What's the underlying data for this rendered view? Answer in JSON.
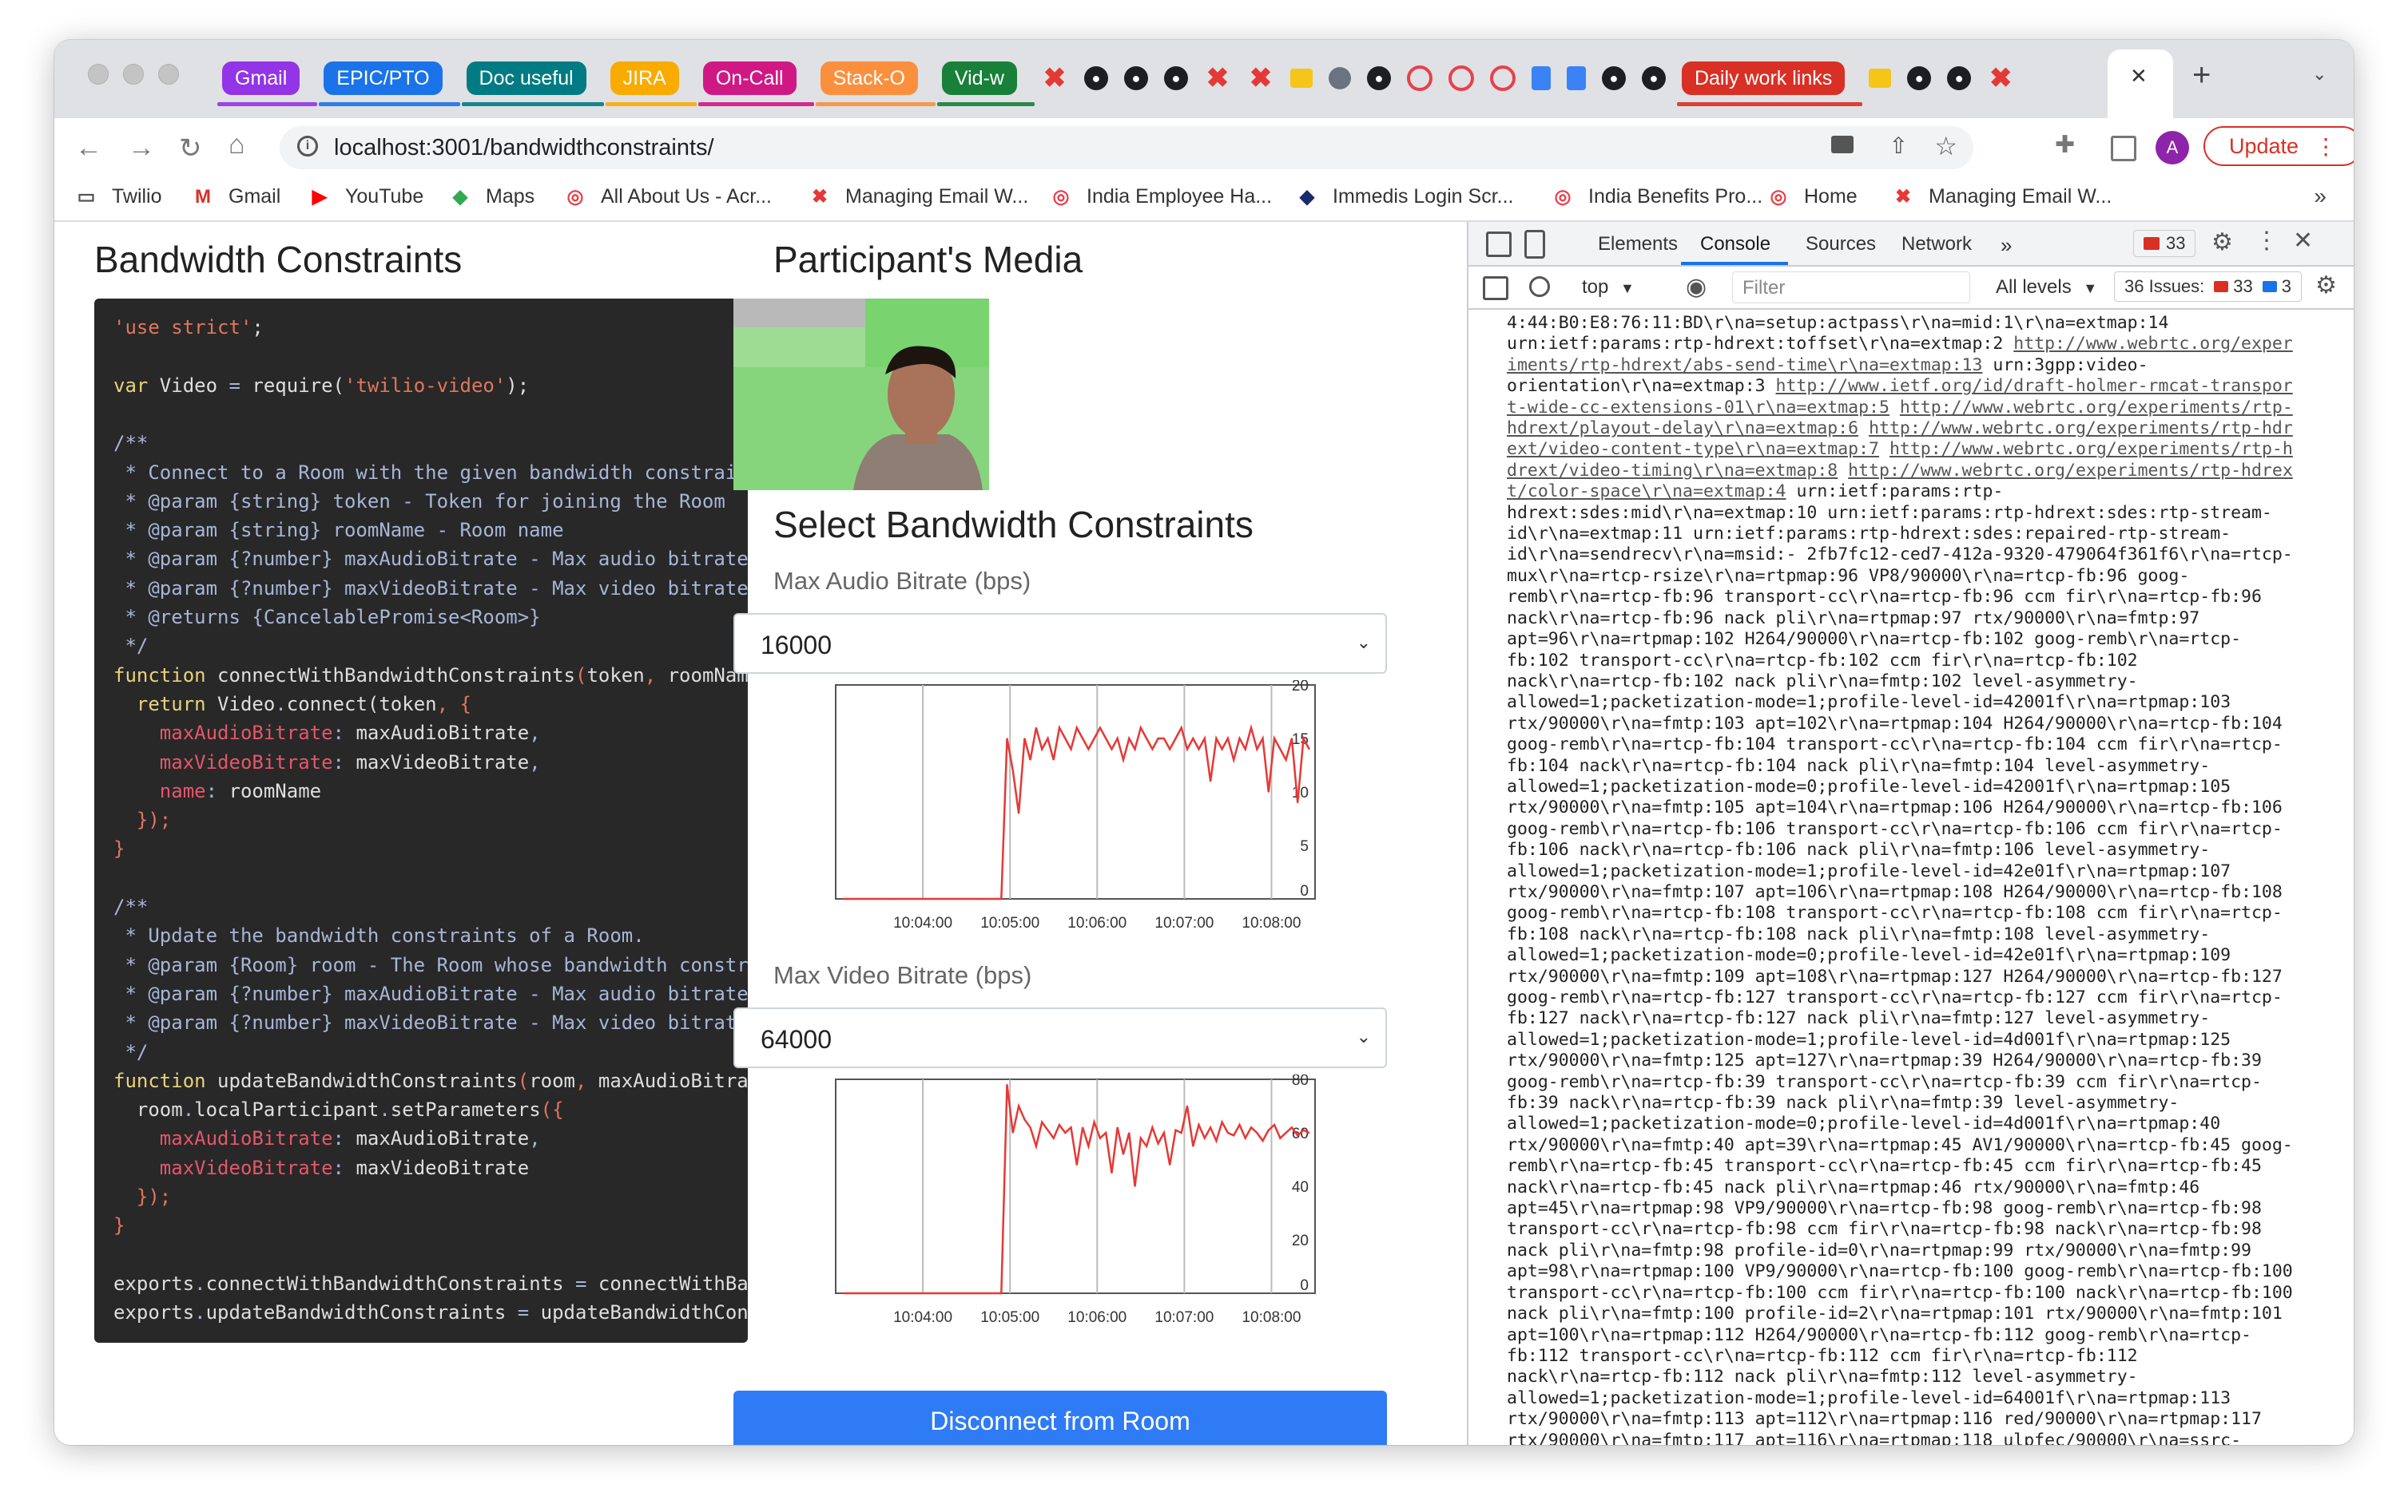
{
  "tabstrip": {
    "group_tabs": [
      {
        "label": "Gmail",
        "color": "#9334e6"
      },
      {
        "label": "EPIC/PTO",
        "color": "#1a73e8"
      },
      {
        "label": "Doc useful",
        "color": "#007b83"
      },
      {
        "label": "JIRA",
        "color": "#f9ab00"
      },
      {
        "label": "On-Call",
        "color": "#d01884"
      },
      {
        "label": "Stack-O",
        "color": "#fa903e"
      },
      {
        "label": "Vid-w",
        "color": "#188038"
      }
    ],
    "daily_tab": {
      "label": "Daily work links",
      "color": "#d93025"
    },
    "close_glyph": "✕",
    "new_tab_glyph": "+"
  },
  "toolbar": {
    "url": "localhost:3001/bandwidthconstraints/",
    "avatar_letter": "A",
    "update_label": "Update"
  },
  "bookmarks": [
    {
      "label": "Twilio",
      "icon": "folder-icon"
    },
    {
      "label": "Gmail",
      "icon": "gmail-icon"
    },
    {
      "label": "YouTube",
      "icon": "youtube-icon"
    },
    {
      "label": "Maps",
      "icon": "maps-icon"
    },
    {
      "label": "All About Us - Acr...",
      "icon": "circle-logo-icon"
    },
    {
      "label": "Managing Email W...",
      "icon": "x-logo-icon"
    },
    {
      "label": "India Employee Ha...",
      "icon": "circle-logo-icon"
    },
    {
      "label": "Immedis Login Scr...",
      "icon": "immedis-icon"
    },
    {
      "label": "India Benefits Pro...",
      "icon": "circle-logo-icon"
    },
    {
      "label": "Home",
      "icon": "circle-logo-icon"
    },
    {
      "label": "Managing Email W...",
      "icon": "x-logo-icon"
    }
  ],
  "bookmarks_overflow": "»",
  "page": {
    "left_title": "Bandwidth Constraints",
    "right_title": "Participant's Media",
    "select_title": "Select Bandwidth Constraints",
    "audio_label": "Max Audio Bitrate (bps)",
    "audio_value": "16000",
    "video_label": "Max Video Bitrate (bps)",
    "video_value": "64000",
    "disconnect_label": "Disconnect from Room"
  },
  "code_lines": [
    [
      [
        "s",
        "'use strict'"
      ],
      [
        "f",
        ";"
      ]
    ],
    [],
    [
      [
        "k",
        "var "
      ],
      [
        "f",
        "Video "
      ],
      [
        "c",
        "= "
      ],
      [
        "f",
        "require("
      ],
      [
        "s",
        "'twilio-video'"
      ],
      [
        "f",
        ");"
      ]
    ],
    [],
    [
      [
        "c",
        "/**"
      ]
    ],
    [
      [
        "c",
        " * Connect to a Room with the given bandwidth constrain"
      ]
    ],
    [
      [
        "c",
        " * @param {string} token - Token for joining the Room"
      ]
    ],
    [
      [
        "c",
        " * @param {string} roomName - Room name"
      ]
    ],
    [
      [
        "c",
        " * @param {?number} maxAudioBitrate - Max audio bitrate"
      ]
    ],
    [
      [
        "c",
        " * @param {?number} maxVideoBitrate - Max video bitrate"
      ]
    ],
    [
      [
        "c",
        " * @returns {CancelablePromise<Room>}"
      ]
    ],
    [
      [
        "c",
        " */"
      ]
    ],
    [
      [
        "k",
        "function "
      ],
      [
        "f",
        "connectWithBandwidthConstraints"
      ],
      [
        "s",
        "("
      ],
      [
        "f",
        "token"
      ],
      [
        "s",
        ", "
      ],
      [
        "f",
        "roomNam"
      ]
    ],
    [
      [
        "k",
        "  return "
      ],
      [
        "f",
        "Video"
      ],
      [
        "c",
        "."
      ],
      [
        "f",
        "connect(token"
      ],
      [
        "s",
        ", {"
      ]
    ],
    [
      [
        "p",
        "    maxAudioBitrate"
      ],
      [
        "c",
        ": "
      ],
      [
        "f",
        "maxAudioBitrate"
      ],
      [
        "c",
        ","
      ]
    ],
    [
      [
        "p",
        "    maxVideoBitrate"
      ],
      [
        "c",
        ": "
      ],
      [
        "f",
        "maxVideoBitrate"
      ],
      [
        "c",
        ","
      ]
    ],
    [
      [
        "p",
        "    name"
      ],
      [
        "c",
        ": "
      ],
      [
        "f",
        "roomName"
      ]
    ],
    [
      [
        "s",
        "  });"
      ]
    ],
    [
      [
        "s",
        "}"
      ]
    ],
    [],
    [
      [
        "c",
        "/**"
      ]
    ],
    [
      [
        "c",
        " * Update the bandwidth constraints of a Room."
      ]
    ],
    [
      [
        "c",
        " * @param {Room} room - The Room whose bandwidth constr"
      ]
    ],
    [
      [
        "c",
        " * @param {?number} maxAudioBitrate - Max audio bitrate"
      ]
    ],
    [
      [
        "c",
        " * @param {?number} maxVideoBitrate - Max video bitrate"
      ]
    ],
    [
      [
        "c",
        " */"
      ]
    ],
    [
      [
        "k",
        "function "
      ],
      [
        "f",
        "updateBandwidthConstraints"
      ],
      [
        "s",
        "("
      ],
      [
        "f",
        "room"
      ],
      [
        "s",
        ", "
      ],
      [
        "f",
        "maxAudioBitra"
      ]
    ],
    [
      [
        "f",
        "  room"
      ],
      [
        "c",
        "."
      ],
      [
        "f",
        "localParticipant"
      ],
      [
        "c",
        "."
      ],
      [
        "f",
        "setParameters"
      ],
      [
        "s",
        "({"
      ]
    ],
    [
      [
        "p",
        "    maxAudioBitrate"
      ],
      [
        "c",
        ": "
      ],
      [
        "f",
        "maxAudioBitrate"
      ],
      [
        "c",
        ","
      ]
    ],
    [
      [
        "p",
        "    maxVideoBitrate"
      ],
      [
        "c",
        ": "
      ],
      [
        "f",
        "maxVideoBitrate"
      ]
    ],
    [
      [
        "s",
        "  });"
      ]
    ],
    [
      [
        "s",
        "}"
      ]
    ],
    [],
    [
      [
        "f",
        "exports"
      ],
      [
        "c",
        "."
      ],
      [
        "f",
        "connectWithBandwidthConstraints "
      ],
      [
        "c",
        "= "
      ],
      [
        "f",
        "connectWithBa"
      ]
    ],
    [
      [
        "f",
        "exports"
      ],
      [
        "c",
        "."
      ],
      [
        "f",
        "updateBandwidthConstraints "
      ],
      [
        "c",
        "= "
      ],
      [
        "f",
        "updateBandwidthCon"
      ]
    ]
  ],
  "devtools": {
    "tabs": [
      "Elements",
      "Console",
      "Sources",
      "Network"
    ],
    "active_tab": "Console",
    "overflow": "»",
    "error_badge": "33",
    "context": "top",
    "filter_placeholder": "Filter",
    "levels": "All levels",
    "issues_label": "36 Issues:",
    "issues_errors": "33",
    "issues_info": "3",
    "console_lines": [
      [
        [
          "t",
          "4:44:B0:E8:76:11:BD\\r\\na=setup:actpass\\r\\na=mid:1\\r\\na=extmap:14"
        ]
      ],
      [
        [
          "t",
          "urn:ietf:params:rtp-hdrext:toffset\\r\\na=extmap:2 "
        ],
        [
          "l",
          "http://www.webrtc.org/exper"
        ]
      ],
      [
        [
          "l",
          "iments/rtp-hdrext/abs-send-time\\r\\na=extmap:13"
        ],
        [
          "t",
          " urn:3gpp:video-"
        ]
      ],
      [
        [
          "t",
          "orientation\\r\\na=extmap:3 "
        ],
        [
          "l",
          "http://www.ietf.org/id/draft-holmer-rmcat-transpor"
        ]
      ],
      [
        [
          "l",
          "t-wide-cc-extensions-01\\r\\na=extmap:5"
        ],
        [
          "t",
          " "
        ],
        [
          "l",
          "http://www.webrtc.org/experiments/rtp-"
        ]
      ],
      [
        [
          "l",
          "hdrext/playout-delay\\r\\na=extmap:6"
        ],
        [
          "t",
          " "
        ],
        [
          "l",
          "http://www.webrtc.org/experiments/rtp-hdr"
        ]
      ],
      [
        [
          "l",
          "ext/video-content-type\\r\\na=extmap:7"
        ],
        [
          "t",
          " "
        ],
        [
          "l",
          "http://www.webrtc.org/experiments/rtp-h"
        ]
      ],
      [
        [
          "l",
          "drext/video-timing\\r\\na=extmap:8"
        ],
        [
          "t",
          " "
        ],
        [
          "l",
          "http://www.webrtc.org/experiments/rtp-hdrex"
        ]
      ],
      [
        [
          "l",
          "t/color-space\\r\\na=extmap:4"
        ],
        [
          "t",
          " urn:ietf:params:rtp-"
        ]
      ],
      [
        [
          "t",
          "hdrext:sdes:mid\\r\\na=extmap:10 urn:ietf:params:rtp-hdrext:sdes:rtp-stream-"
        ]
      ],
      [
        [
          "t",
          "id\\r\\na=extmap:11 urn:ietf:params:rtp-hdrext:sdes:repaired-rtp-stream-"
        ]
      ],
      [
        [
          "t",
          "id\\r\\na=sendrecv\\r\\na=msid:- 2fb7fc12-ced7-412a-9320-479064f361f6\\r\\na=rtcp-"
        ]
      ],
      [
        [
          "t",
          "mux\\r\\na=rtcp-rsize\\r\\na=rtpmap:96 VP8/90000\\r\\na=rtcp-fb:96 goog-"
        ]
      ],
      [
        [
          "t",
          "remb\\r\\na=rtcp-fb:96 transport-cc\\r\\na=rtcp-fb:96 ccm fir\\r\\na=rtcp-fb:96"
        ]
      ],
      [
        [
          "t",
          "nack\\r\\na=rtcp-fb:96 nack pli\\r\\na=rtpmap:97 rtx/90000\\r\\na=fmtp:97"
        ]
      ],
      [
        [
          "t",
          "apt=96\\r\\na=rtpmap:102 H264/90000\\r\\na=rtcp-fb:102 goog-remb\\r\\na=rtcp-"
        ]
      ],
      [
        [
          "t",
          "fb:102 transport-cc\\r\\na=rtcp-fb:102 ccm fir\\r\\na=rtcp-fb:102"
        ]
      ],
      [
        [
          "t",
          "nack\\r\\na=rtcp-fb:102 nack pli\\r\\na=fmtp:102 level-asymmetry-"
        ]
      ],
      [
        [
          "t",
          "allowed=1;packetization-mode=1;profile-level-id=42001f\\r\\na=rtpmap:103"
        ]
      ],
      [
        [
          "t",
          "rtx/90000\\r\\na=fmtp:103 apt=102\\r\\na=rtpmap:104 H264/90000\\r\\na=rtcp-fb:104"
        ]
      ],
      [
        [
          "t",
          "goog-remb\\r\\na=rtcp-fb:104 transport-cc\\r\\na=rtcp-fb:104 ccm fir\\r\\na=rtcp-"
        ]
      ],
      [
        [
          "t",
          "fb:104 nack\\r\\na=rtcp-fb:104 nack pli\\r\\na=fmtp:104 level-asymmetry-"
        ]
      ],
      [
        [
          "t",
          "allowed=1;packetization-mode=0;profile-level-id=42001f\\r\\na=rtpmap:105"
        ]
      ],
      [
        [
          "t",
          "rtx/90000\\r\\na=fmtp:105 apt=104\\r\\na=rtpmap:106 H264/90000\\r\\na=rtcp-fb:106"
        ]
      ],
      [
        [
          "t",
          "goog-remb\\r\\na=rtcp-fb:106 transport-cc\\r\\na=rtcp-fb:106 ccm fir\\r\\na=rtcp-"
        ]
      ],
      [
        [
          "t",
          "fb:106 nack\\r\\na=rtcp-fb:106 nack pli\\r\\na=fmtp:106 level-asymmetry-"
        ]
      ],
      [
        [
          "t",
          "allowed=1;packetization-mode=1;profile-level-id=42e01f\\r\\na=rtpmap:107"
        ]
      ],
      [
        [
          "t",
          "rtx/90000\\r\\na=fmtp:107 apt=106\\r\\na=rtpmap:108 H264/90000\\r\\na=rtcp-fb:108"
        ]
      ],
      [
        [
          "t",
          "goog-remb\\r\\na=rtcp-fb:108 transport-cc\\r\\na=rtcp-fb:108 ccm fir\\r\\na=rtcp-"
        ]
      ],
      [
        [
          "t",
          "fb:108 nack\\r\\na=rtcp-fb:108 nack pli\\r\\na=fmtp:108 level-asymmetry-"
        ]
      ],
      [
        [
          "t",
          "allowed=1;packetization-mode=0;profile-level-id=42e01f\\r\\na=rtpmap:109"
        ]
      ],
      [
        [
          "t",
          "rtx/90000\\r\\na=fmtp:109 apt=108\\r\\na=rtpmap:127 H264/90000\\r\\na=rtcp-fb:127"
        ]
      ],
      [
        [
          "t",
          "goog-remb\\r\\na=rtcp-fb:127 transport-cc\\r\\na=rtcp-fb:127 ccm fir\\r\\na=rtcp-"
        ]
      ],
      [
        [
          "t",
          "fb:127 nack\\r\\na=rtcp-fb:127 nack pli\\r\\na=fmtp:127 level-asymmetry-"
        ]
      ],
      [
        [
          "t",
          "allowed=1;packetization-mode=1;profile-level-id=4d001f\\r\\na=rtpmap:125"
        ]
      ],
      [
        [
          "t",
          "rtx/90000\\r\\na=fmtp:125 apt=127\\r\\na=rtpmap:39 H264/90000\\r\\na=rtcp-fb:39"
        ]
      ],
      [
        [
          "t",
          "goog-remb\\r\\na=rtcp-fb:39 transport-cc\\r\\na=rtcp-fb:39 ccm fir\\r\\na=rtcp-"
        ]
      ],
      [
        [
          "t",
          "fb:39 nack\\r\\na=rtcp-fb:39 nack pli\\r\\na=fmtp:39 level-asymmetry-"
        ]
      ],
      [
        [
          "t",
          "allowed=1;packetization-mode=0;profile-level-id=4d001f\\r\\na=rtpmap:40"
        ]
      ],
      [
        [
          "t",
          "rtx/90000\\r\\na=fmtp:40 apt=39\\r\\na=rtpmap:45 AV1/90000\\r\\na=rtcp-fb:45 goog-"
        ]
      ],
      [
        [
          "t",
          "remb\\r\\na=rtcp-fb:45 transport-cc\\r\\na=rtcp-fb:45 ccm fir\\r\\na=rtcp-fb:45"
        ]
      ],
      [
        [
          "t",
          "nack\\r\\na=rtcp-fb:45 nack pli\\r\\na=rtpmap:46 rtx/90000\\r\\na=fmtp:46"
        ]
      ],
      [
        [
          "t",
          "apt=45\\r\\na=rtpmap:98 VP9/90000\\r\\na=rtcp-fb:98 goog-remb\\r\\na=rtcp-fb:98"
        ]
      ],
      [
        [
          "t",
          "transport-cc\\r\\na=rtcp-fb:98 ccm fir\\r\\na=rtcp-fb:98 nack\\r\\na=rtcp-fb:98"
        ]
      ],
      [
        [
          "t",
          "nack pli\\r\\na=fmtp:98 profile-id=0\\r\\na=rtpmap:99 rtx/90000\\r\\na=fmtp:99"
        ]
      ],
      [
        [
          "t",
          "apt=98\\r\\na=rtpmap:100 VP9/90000\\r\\na=rtcp-fb:100 goog-remb\\r\\na=rtcp-fb:100"
        ]
      ],
      [
        [
          "t",
          "transport-cc\\r\\na=rtcp-fb:100 ccm fir\\r\\na=rtcp-fb:100 nack\\r\\na=rtcp-fb:100"
        ]
      ],
      [
        [
          "t",
          "nack pli\\r\\na=fmtp:100 profile-id=2\\r\\na=rtpmap:101 rtx/90000\\r\\na=fmtp:101"
        ]
      ],
      [
        [
          "t",
          "apt=100\\r\\na=rtpmap:112 H264/90000\\r\\na=rtcp-fb:112 goog-remb\\r\\na=rtcp-"
        ]
      ],
      [
        [
          "t",
          "fb:112 transport-cc\\r\\na=rtcp-fb:112 ccm fir\\r\\na=rtcp-fb:112"
        ]
      ],
      [
        [
          "t",
          "nack\\r\\na=rtcp-fb:112 nack pli\\r\\na=fmtp:112 level-asymmetry-"
        ]
      ],
      [
        [
          "t",
          "allowed=1;packetization-mode=1;profile-level-id=64001f\\r\\na=rtpmap:113"
        ]
      ],
      [
        [
          "t",
          "rtx/90000\\r\\na=fmtp:113 apt=112\\r\\na=rtpmap:116 red/90000\\r\\na=rtpmap:117"
        ]
      ],
      [
        [
          "t",
          "rtx/90000\\r\\na=fmtp:117 apt=116\\r\\na=rtpmap:118 ulpfec/90000\\r\\na=ssrc-"
        ]
      ]
    ]
  },
  "chart_data": [
    {
      "type": "line",
      "x_ticks": [
        "10:04:00",
        "10:05:00",
        "10:06:00",
        "10:07:00",
        "10:08:00"
      ],
      "y_ticks": [
        "0",
        "5",
        "10",
        "15",
        "20"
      ],
      "ylim": [
        0,
        20
      ],
      "color": "#e53935",
      "x": [
        "10:03:05",
        "10:03:20",
        "10:03:40",
        "10:04:00",
        "10:04:20",
        "10:04:40",
        "10:04:50",
        "10:04:54",
        "10:04:58",
        "10:05:02",
        "10:05:06",
        "10:05:10",
        "10:05:14",
        "10:05:18",
        "10:05:22",
        "10:05:26",
        "10:05:30",
        "10:05:34",
        "10:05:38",
        "10:05:42",
        "10:05:46",
        "10:05:50",
        "10:05:54",
        "10:05:58",
        "10:06:02",
        "10:06:06",
        "10:06:10",
        "10:06:14",
        "10:06:18",
        "10:06:22",
        "10:06:26",
        "10:06:30",
        "10:06:34",
        "10:06:38",
        "10:06:42",
        "10:06:46",
        "10:06:50",
        "10:06:54",
        "10:06:58",
        "10:07:02",
        "10:07:06",
        "10:07:10",
        "10:07:14",
        "10:07:18",
        "10:07:22",
        "10:07:26",
        "10:07:30",
        "10:07:34",
        "10:07:38",
        "10:07:42",
        "10:07:46",
        "10:07:50",
        "10:07:54",
        "10:07:58",
        "10:08:02",
        "10:08:06",
        "10:08:10",
        "10:08:14",
        "10:08:18",
        "10:08:22",
        "10:08:26"
      ],
      "values": [
        0,
        0,
        0,
        0,
        0,
        0,
        0,
        0,
        15,
        12,
        8,
        15,
        13,
        16,
        14,
        15,
        13,
        16,
        15,
        14,
        16,
        15,
        14,
        15,
        16,
        15,
        14,
        15,
        13,
        15,
        14,
        16,
        15,
        14,
        15,
        15,
        14,
        15,
        16,
        14,
        15,
        14,
        15,
        11,
        15,
        14,
        15,
        13,
        15,
        14,
        16,
        14,
        15,
        10,
        15,
        14,
        13,
        15,
        9,
        15,
        14
      ]
    },
    {
      "type": "line",
      "x_ticks": [
        "10:04:00",
        "10:05:00",
        "10:06:00",
        "10:07:00",
        "10:08:00"
      ],
      "y_ticks": [
        "0",
        "20",
        "40",
        "60",
        "80"
      ],
      "ylim": [
        0,
        80
      ],
      "color": "#e53935",
      "x": [
        "10:03:05",
        "10:03:20",
        "10:03:40",
        "10:04:00",
        "10:04:20",
        "10:04:40",
        "10:04:50",
        "10:04:54",
        "10:04:58",
        "10:05:02",
        "10:05:06",
        "10:05:10",
        "10:05:14",
        "10:05:18",
        "10:05:22",
        "10:05:26",
        "10:05:30",
        "10:05:34",
        "10:05:38",
        "10:05:42",
        "10:05:46",
        "10:05:50",
        "10:05:54",
        "10:05:58",
        "10:06:02",
        "10:06:06",
        "10:06:10",
        "10:06:14",
        "10:06:18",
        "10:06:22",
        "10:06:26",
        "10:06:30",
        "10:06:34",
        "10:06:38",
        "10:06:42",
        "10:06:46",
        "10:06:50",
        "10:06:54",
        "10:06:58",
        "10:07:02",
        "10:07:06",
        "10:07:10",
        "10:07:14",
        "10:07:18",
        "10:07:22",
        "10:07:26",
        "10:07:30",
        "10:07:34",
        "10:07:38",
        "10:07:42",
        "10:07:46",
        "10:07:50",
        "10:07:54",
        "10:07:58",
        "10:08:02",
        "10:08:06",
        "10:08:10",
        "10:08:14",
        "10:08:18",
        "10:08:22",
        "10:08:26"
      ],
      "values": [
        0,
        0,
        0,
        0,
        0,
        0,
        0,
        0,
        78,
        60,
        70,
        65,
        62,
        55,
        64,
        61,
        58,
        63,
        60,
        62,
        48,
        62,
        55,
        64,
        58,
        60,
        45,
        62,
        52,
        60,
        40,
        58,
        55,
        62,
        56,
        60,
        48,
        61,
        60,
        70,
        55,
        63,
        58,
        62,
        57,
        64,
        60,
        59,
        63,
        58,
        62,
        60,
        57,
        61,
        63,
        58,
        60,
        62,
        59,
        61,
        60
      ]
    }
  ]
}
